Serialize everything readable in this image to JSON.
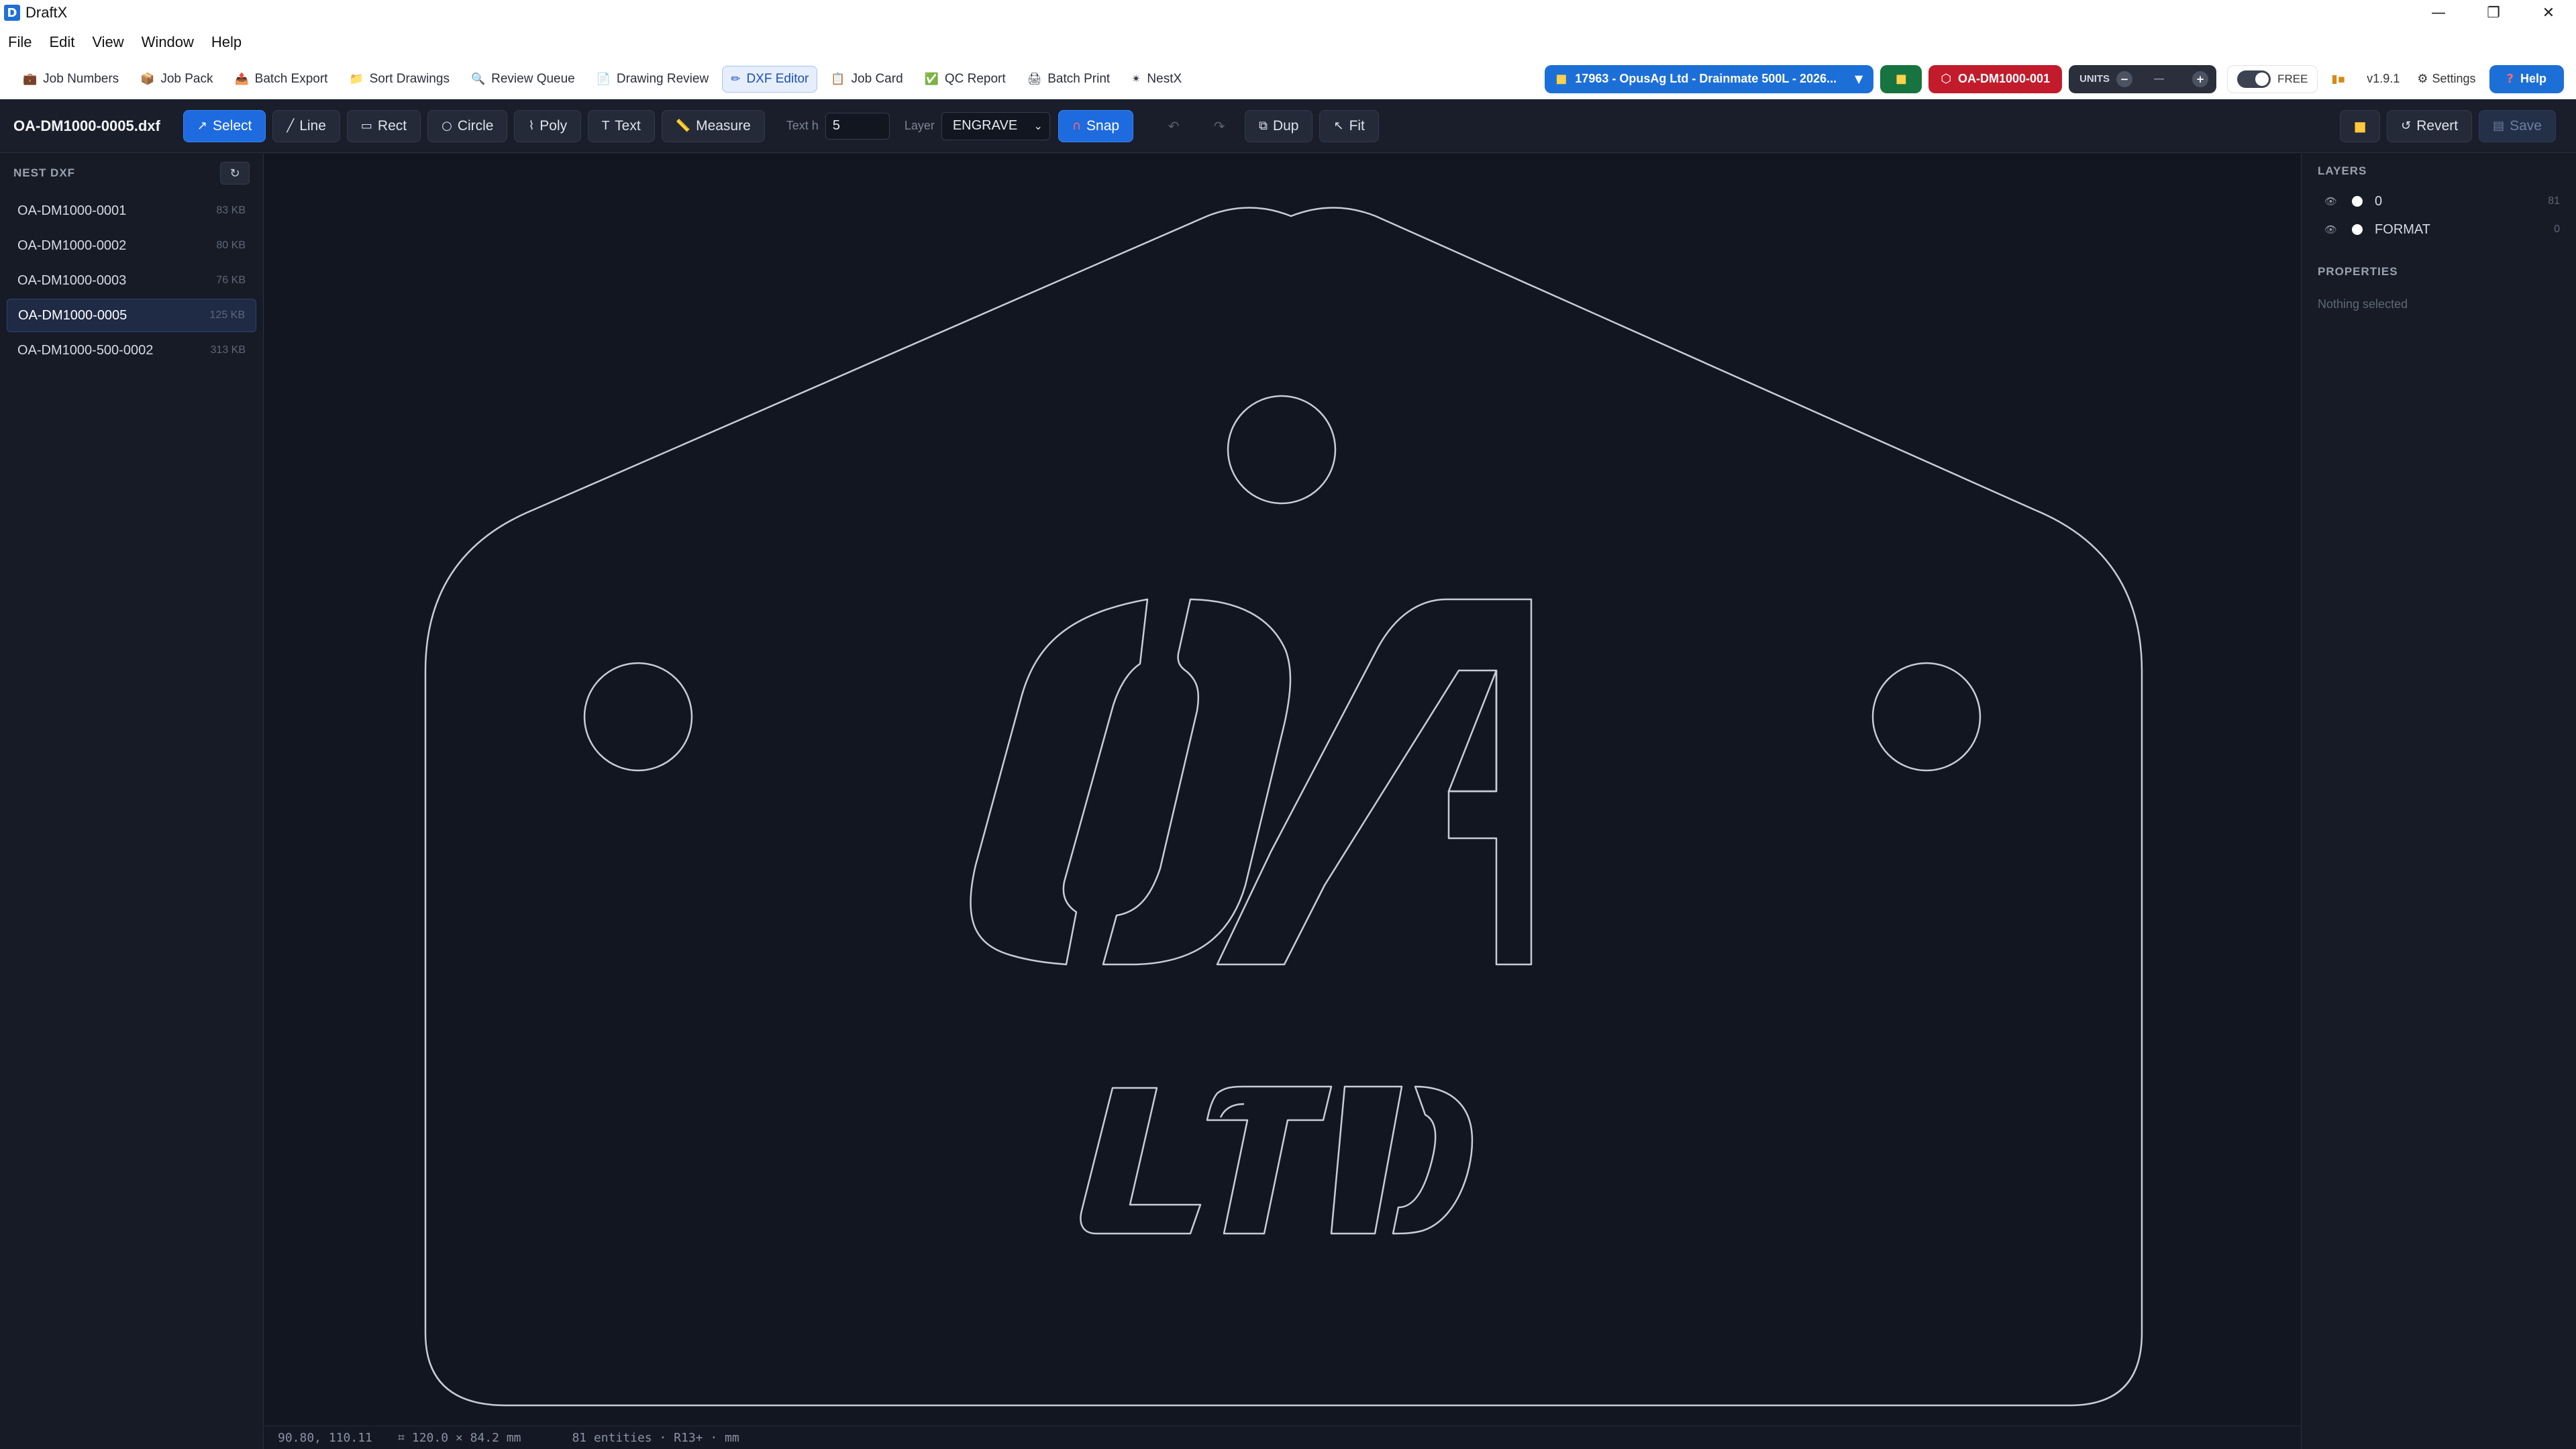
{
  "window": {
    "title": "DraftX",
    "app_icon_letter": "D",
    "controls": [
      "—",
      "❐",
      "✕"
    ]
  },
  "menu": [
    "File",
    "Edit",
    "View",
    "Window",
    "Help"
  ],
  "nav": {
    "items": [
      {
        "label": "Job Numbers",
        "icon": "💼"
      },
      {
        "label": "Job Pack",
        "icon": "📦"
      },
      {
        "label": "Batch Export",
        "icon": "📤"
      },
      {
        "label": "Sort Drawings",
        "icon": "📁"
      },
      {
        "label": "Review Queue",
        "icon": "🔍"
      },
      {
        "label": "Drawing Review",
        "icon": "📄"
      },
      {
        "label": "DXF Editor",
        "icon": "✏"
      },
      {
        "label": "Job Card",
        "icon": "📋"
      },
      {
        "label": "QC Report",
        "icon": "✅"
      },
      {
        "label": "Batch Print",
        "icon": "🖨"
      },
      {
        "label": "NestX",
        "icon": "✴"
      }
    ],
    "active_index": 6,
    "job_selector": "17963 - OpusAg Ltd - Drainmate 500L - 2026...",
    "part_label": "OA-DM1000-001",
    "units_label": "UNITS",
    "units_minus": "−",
    "units_value": "—",
    "units_plus": "+",
    "free_label": "FREE",
    "version": "v1.9.1",
    "settings_label": "Settings",
    "help_label": "Help"
  },
  "editor_toolbar": {
    "filename": "OA-DM1000-0005.dxf",
    "tools": {
      "select": "Select",
      "line": "Line",
      "rect": "Rect",
      "circle": "Circle",
      "poly": "Poly",
      "text": "Text",
      "measure": "Measure"
    },
    "text_h_label": "Text h",
    "text_h_value": "5",
    "layer_label": "Layer",
    "layer_value": "ENGRAVE",
    "snap_label": "Snap",
    "dup_label": "Dup",
    "fit_label": "Fit",
    "revert_label": "Revert",
    "save_label": "Save"
  },
  "sidebar": {
    "title": "NEST DXF",
    "files": [
      {
        "name": "OA-DM1000-0001",
        "size": "83 KB"
      },
      {
        "name": "OA-DM1000-0002",
        "size": "80 KB"
      },
      {
        "name": "OA-DM1000-0003",
        "size": "76 KB"
      },
      {
        "name": "OA-DM1000-0005",
        "size": "125 KB"
      },
      {
        "name": "OA-DM1000-500-0002",
        "size": "313 KB"
      }
    ],
    "selected_index": 3
  },
  "right_panel": {
    "layers_title": "LAYERS",
    "layers": [
      {
        "name": "0",
        "count": "81"
      },
      {
        "name": "FORMAT",
        "count": "0"
      }
    ],
    "properties_title": "PROPERTIES",
    "properties_empty": "Nothing selected"
  },
  "status": {
    "cursor": "90.80, 110.11",
    "dimensions": "120.0 × 84.2 mm",
    "entities": "81 entities · R13+ · mm"
  },
  "colors": {
    "accent": "#1e6be0",
    "canvas_bg": "#121621",
    "outline": "#c8ccd6",
    "part_pill": "#c21c2c",
    "folder_green": "#17733f"
  }
}
